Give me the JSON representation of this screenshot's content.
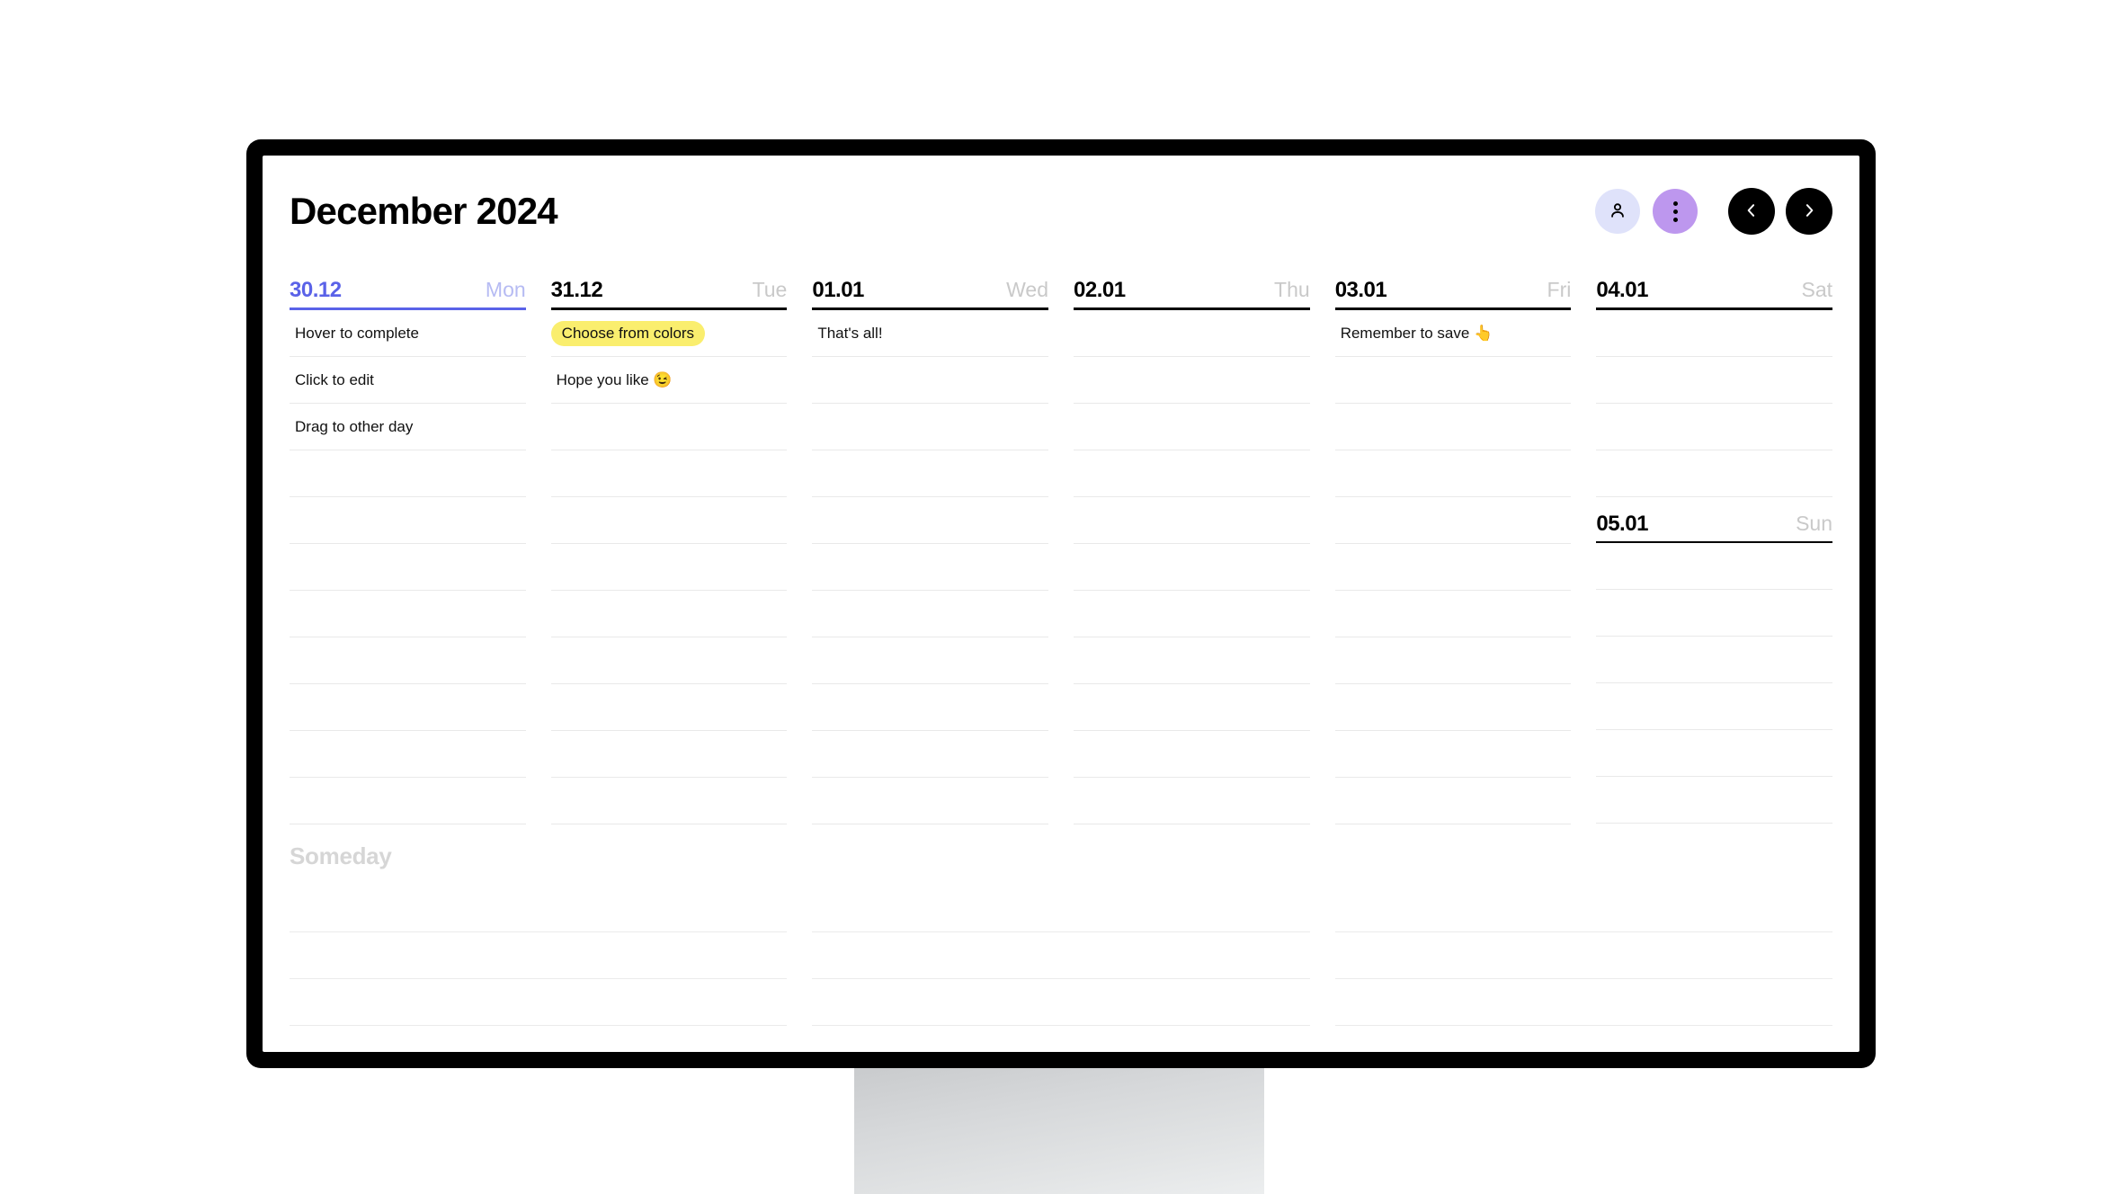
{
  "header": {
    "title": "December 2024",
    "actions": [
      {
        "name": "profile-button",
        "icon": "user-icon",
        "color": "#dfe2fa"
      },
      {
        "name": "more-button",
        "icon": "more-vertical-icon",
        "color": "#bd97ee"
      },
      {
        "name": "prev-week-button",
        "icon": "chevron-left-icon",
        "color": "#000000"
      },
      {
        "name": "next-week-button",
        "icon": "chevron-right-icon",
        "color": "#000000"
      }
    ]
  },
  "colors": {
    "today_accent": "#5a62e8",
    "today_name": "#b6bbf3",
    "highlight_yellow": "#faee6e",
    "day_name_grey": "#c9c9c9",
    "rule_grey": "#e9e9e9",
    "someday_grey": "#d6d6d6",
    "bezel": "#000000"
  },
  "week": {
    "days": [
      {
        "date": "30.12",
        "weekday": "Mon",
        "is_today": true,
        "tasks": [
          {
            "text": "Hover to complete",
            "highlight": "none"
          },
          {
            "text": "Click to edit",
            "highlight": "none"
          },
          {
            "text": "Drag to other day",
            "highlight": "none"
          }
        ],
        "empty_slots": 8
      },
      {
        "date": "31.12",
        "weekday": "Tue",
        "is_today": false,
        "tasks": [
          {
            "text": "Choose from colors",
            "highlight": "yellow"
          },
          {
            "text": "Hope you like 😉",
            "highlight": "none"
          }
        ],
        "empty_slots": 9
      },
      {
        "date": "01.01",
        "weekday": "Wed",
        "is_today": false,
        "tasks": [
          {
            "text": "That's all!",
            "highlight": "none"
          }
        ],
        "empty_slots": 10
      },
      {
        "date": "02.01",
        "weekday": "Thu",
        "is_today": false,
        "tasks": [],
        "empty_slots": 11
      },
      {
        "date": "03.01",
        "weekday": "Fri",
        "is_today": false,
        "tasks": [
          {
            "text": "Remember to save 👆",
            "highlight": "none"
          }
        ],
        "empty_slots": 10
      }
    ],
    "weekend_column": {
      "saturday": {
        "date": "04.01",
        "weekday": "Sat",
        "is_today": false,
        "tasks": [],
        "empty_slots": 4
      },
      "sunday": {
        "date": "05.01",
        "weekday": "Sun",
        "is_today": false,
        "tasks": [],
        "empty_slots": 6
      }
    }
  },
  "someday": {
    "title": "Someday",
    "columns": [
      {
        "slots": 3
      },
      {
        "slots": 3
      },
      {
        "slots": 3
      }
    ]
  }
}
